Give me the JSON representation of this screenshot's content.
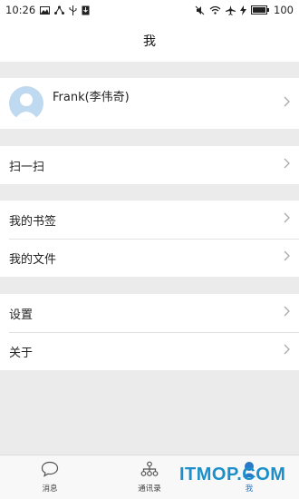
{
  "statusbar": {
    "time": "10:26",
    "battery": "100"
  },
  "header": {
    "title": "我"
  },
  "profile": {
    "name": "Frank(李伟奇)"
  },
  "menu": {
    "scan": "扫一扫",
    "bookmarks": "我的书签",
    "files": "我的文件",
    "settings": "设置",
    "about": "关于"
  },
  "tabs": [
    {
      "label": "消息",
      "icon": "chat-bubble-icon"
    },
    {
      "label": "通讯录",
      "icon": "org-chart-icon"
    },
    {
      "label": "我",
      "icon": "person-icon",
      "active": true
    }
  ],
  "watermark": "ITMOP.COM",
  "colors": {
    "accent": "#2a78c8",
    "background": "#ebebeb"
  }
}
